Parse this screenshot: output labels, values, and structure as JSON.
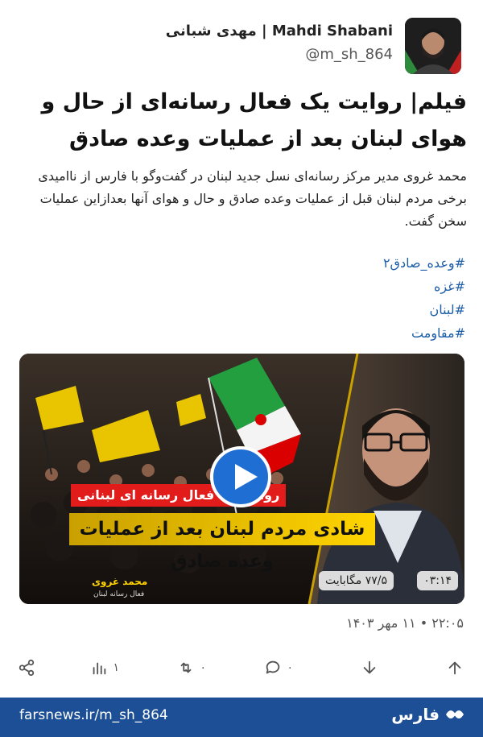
{
  "author": {
    "name_line": "مهدی شبانی | Mahdi Shabani",
    "handle": "@m_sh_864"
  },
  "post": {
    "title": "فیلم| روایت یک فعال رسانه‌ای از حال و هوای لبنان بعد از عملیات وعده صادق",
    "body": "محمد غروی مدیر مرکز رسانه‌ای نسل جدید لبنان در گفت‌وگو با فارس از ناامیدی برخی مردم لبنان قبل از عملیات وعده صادق و حال و هوای آنها بعدازاین عملیات سخن گفت.",
    "hashtags": [
      "#وعده_صادق۲",
      "#غزه",
      "#لبنان",
      "#مقاومت"
    ],
    "timestamp": "۲۲:۰۵ • ۱۱ مهر ۱۴۰۳"
  },
  "video": {
    "subtitle": "روایت یک فعال رسانه ای لبنانی",
    "banner": "شادی مردم لبنان بعد از عملیات وعده صادق",
    "person_name": "محمد غروی",
    "person_role": "فعال رسانه لبنان",
    "duration": "۰۳:۱۴",
    "size": "۷۷/۵ مگابایت"
  },
  "actions": {
    "views": "۱",
    "retweets": "۰",
    "replies": "۰"
  },
  "footer": {
    "url": "farsnews.ir/m_sh_864",
    "brand": "فارس"
  },
  "colors": {
    "link": "#1d5ea8",
    "footer_bg": "#1c4f95",
    "play_button": "#1f6ed4",
    "banner_yellow": "#ffd400",
    "subtitle_red": "#e21b1b"
  }
}
